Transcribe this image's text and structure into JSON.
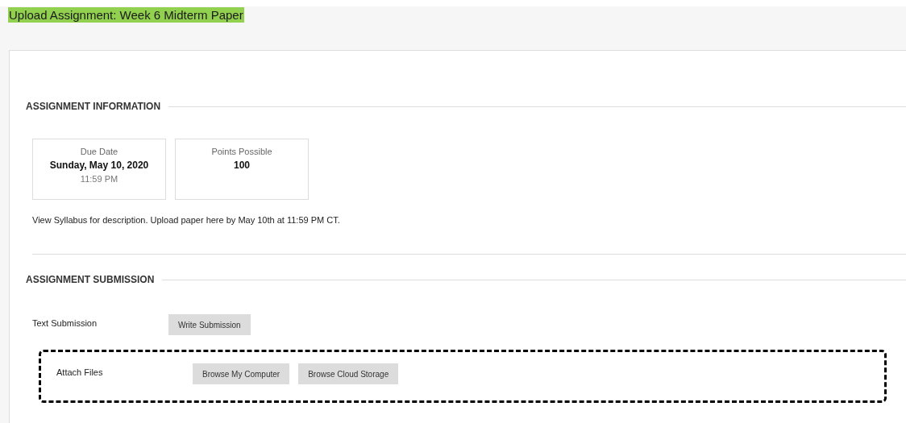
{
  "page_title": "Upload Assignment: Week 6 Midterm Paper",
  "information": {
    "heading": "ASSIGNMENT INFORMATION",
    "cards": [
      {
        "label": "Due Date",
        "value": "Sunday, May 10, 2020",
        "detail": "11:59 PM"
      },
      {
        "label": "Points Possible",
        "value": "100"
      }
    ],
    "description": "View Syllabus for description. Upload paper here by May 10th at 11:59 PM CT."
  },
  "submission": {
    "heading": "ASSIGNMENT SUBMISSION",
    "rows": [
      {
        "label": "Text Submission",
        "highlighted": false,
        "buttons": [
          "Write Submission"
        ]
      },
      {
        "label": "Attach Files",
        "highlighted": true,
        "buttons": [
          "Browse My Computer",
          "Browse Cloud Storage"
        ]
      }
    ]
  }
}
